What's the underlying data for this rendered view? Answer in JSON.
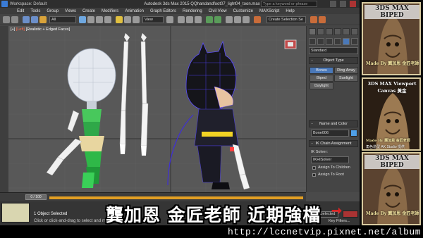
{
  "titlebar": {
    "workspace": "Workspace: Default",
    "title": "Autodesk 3ds Max 2015     QQhandandfoot07_light04_toon.max",
    "search_placeholder": "Type a keyword or phrase"
  },
  "menubar": [
    "Edit",
    "Tools",
    "Group",
    "Views",
    "Create",
    "Modifiers",
    "Animation",
    "Graph Editors",
    "Rendering",
    "Civil View",
    "Customize",
    "MAXScript",
    "Help"
  ],
  "toolbar": {
    "filter": "All",
    "view": "View",
    "selection_set": "Create Selection Se"
  },
  "viewport": {
    "label_prefix": "[+]",
    "label_active": "[Left]",
    "label_rest": "[Realistic + Edged Faces]"
  },
  "command_panel": {
    "category": "Standard",
    "object_type_title": "Object Type",
    "buttons": [
      "Bones",
      "Ring Array",
      "Biped",
      "Sunlight",
      "Daylight"
    ],
    "name_color_title": "Name and Color",
    "name_value": "Bone006",
    "ik_title": "IK Chain Assignment",
    "ik_solver_label": "IK Solver:",
    "ik_solver_value": "IKHISolver",
    "assign_children": "Assign To Children",
    "assign_root": "Assign To Root",
    "swatch_color": "#4fa0e8"
  },
  "timeline": {
    "frame": "0 / 100"
  },
  "status": {
    "selected": "1 Object Selected",
    "hint": "Click or click-and-drag to select and move objects",
    "selection_mode": "Selected",
    "key_filters": "Key Filters..."
  },
  "subtitle": "龔加恩 金匠老師 近期強檔",
  "arrow": "➞",
  "footer_url": "http://lccnetvip.pixnet.net/album",
  "thumbs": [
    {
      "title": "3DS MAX BIPED",
      "by": "Made By 龔加恩 金匠老師",
      "sub": ""
    },
    {
      "title": "3DS MAX Viewport Canvas 黃金",
      "by": "Made By 龔加恩 金匠老師",
      "sub": "角色造型   AK Studio 提供"
    },
    {
      "title": "3DS MAX BIPED",
      "by": "Made By 龔加恩 金匠老師",
      "sub": ""
    }
  ]
}
